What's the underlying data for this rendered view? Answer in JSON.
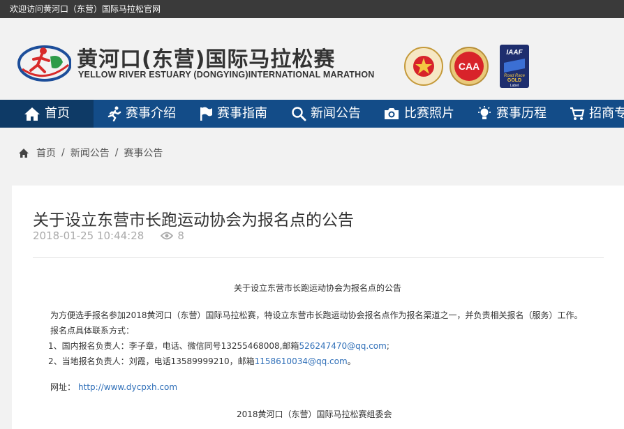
{
  "topbar": {
    "welcome": "欢迎访问黄河口（东营）国际马拉松官网"
  },
  "brand": {
    "name_cn": "黄河口(东营)国际马拉松赛",
    "name_en": "YELLOW RIVER ESTUARY (DONGYING)INTERNATIONAL MARATHON"
  },
  "badges": {
    "caa": "CAA",
    "caa_small": "Road Race",
    "caa_bottom": "金牌赛事",
    "iaaf": "IAAF",
    "iaaf_line1": "Road Race",
    "iaaf_line2": "GOLD",
    "iaaf_line3": "Label",
    "chinese_aa": "CHINESE ATHLETIC ASSOCIATION",
    "chinese_aa_bottom": "中国田径协会"
  },
  "nav": {
    "home": "首页",
    "intro": "赛事介绍",
    "guide": "赛事指南",
    "news": "新闻公告",
    "photos": "比赛照片",
    "history": "赛事历程",
    "sponsor": "招商专"
  },
  "breadcrumb": {
    "home": "首页",
    "news": "新闻公告",
    "current": "赛事公告"
  },
  "article": {
    "title": "关于设立东营市长跑运动协会为报名点的公告",
    "date": "2018-01-25 10:44:28",
    "views": "8",
    "heading": "关于设立东营市长跑运动协会为报名点的公告",
    "para1": "为方便选手报名参加2018黄河口（东营）国际马拉松赛，特设立东营市长跑运动协会报名点作为报名渠道之一，并负责相关报名（服务）工作。",
    "para2": "报名点具体联系方式：",
    "line1_text": "1、国内报名负责人：李子章，电话、微信同号13255468008,邮箱",
    "line1_email": "526247470@qq.com",
    "line1_end": ";",
    "line2_text": "2、当地报名负责人：刘霞，电话13589999210，邮箱",
    "line2_email": "1158610034@qq.com",
    "line2_end": "。",
    "url_label": "网址：",
    "url": "http://www.dycpxh.com",
    "sign": "2018黄河口（东营）国际马拉松赛组委会"
  },
  "colors": {
    "nav_bg": "#134c88",
    "link": "#2f6fb8",
    "topbar_bg": "#3a3a3a"
  }
}
